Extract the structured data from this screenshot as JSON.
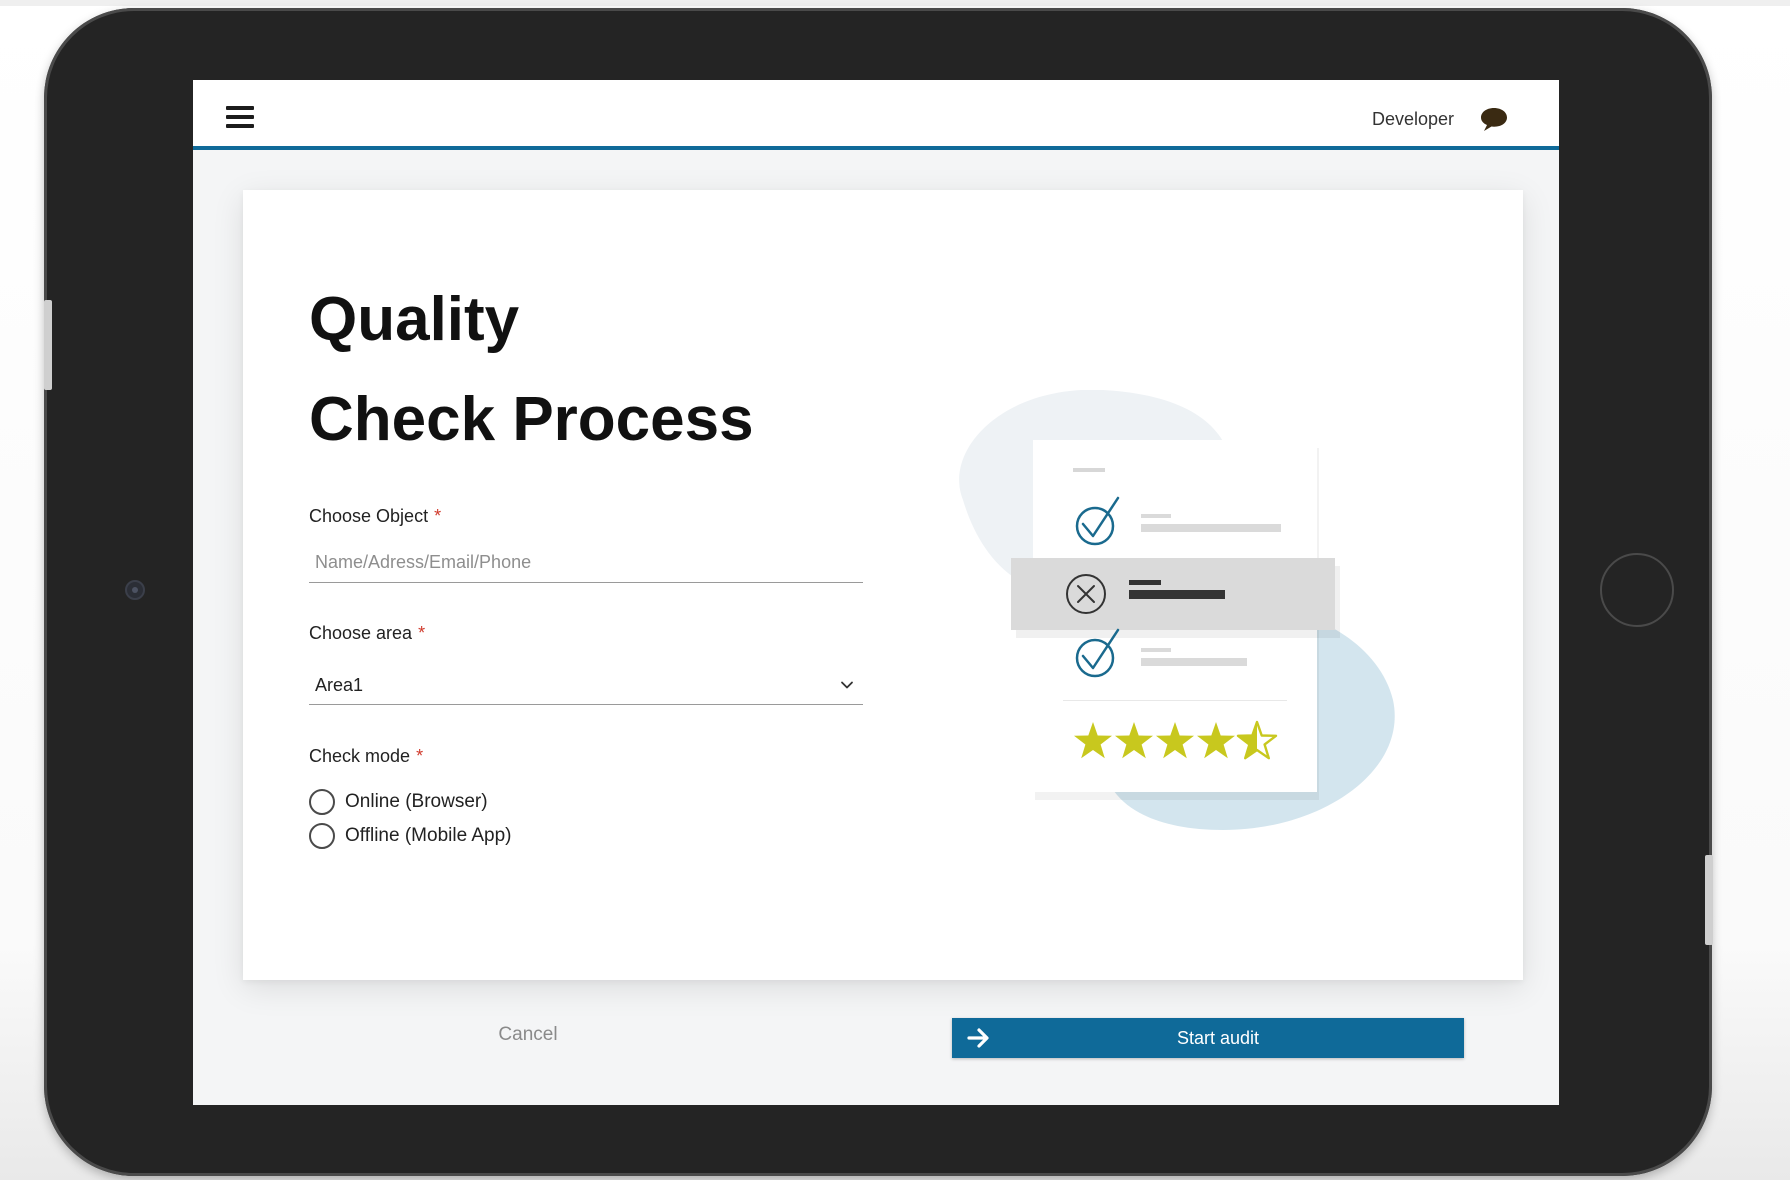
{
  "header": {
    "user": "Developer"
  },
  "form": {
    "title_line1": "Quality",
    "title_line2": "Check Process",
    "object_label": "Choose Object",
    "object_required": "*",
    "object_placeholder": "Name/Adress/Email/Phone",
    "area_label": "Choose area",
    "area_required": "*",
    "area_value": "Area1",
    "mode_label": "Check mode",
    "mode_required": "*",
    "mode_options": [
      {
        "label": "Online (Browser)",
        "selected": false
      },
      {
        "label": "Offline (Mobile App)",
        "selected": false
      }
    ]
  },
  "illustration": {
    "rating_full_stars": 4,
    "rating_half_star": true,
    "icons": [
      "check-icon",
      "x-circle-icon",
      "check-icon",
      "star-icon"
    ]
  },
  "footer": {
    "cancel_label": "Cancel",
    "start_label": "Start audit"
  },
  "colors": {
    "accent": "#0f6a99",
    "star": "#c8c81e",
    "required": "#d0392b",
    "blob": "#d6e7ef"
  }
}
